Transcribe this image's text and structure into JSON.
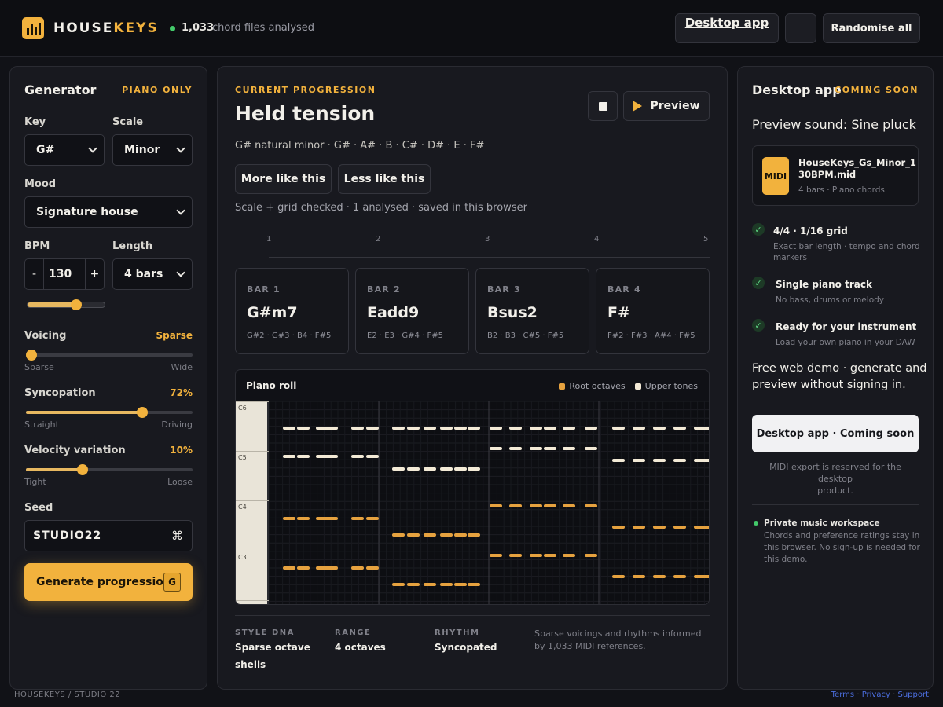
{
  "header": {
    "brand_part1": "HOUSE",
    "brand_part2": "KEYS",
    "files_count": "1,033",
    "files_text": "chord files analysed",
    "desktop_app_link": "Desktop app",
    "randomise_label": "Randomise all"
  },
  "generator": {
    "title": "Generator",
    "tag": "PIANO ONLY",
    "key_label": "Key",
    "key_value": "G#",
    "scale_label": "Scale",
    "scale_value": "Minor",
    "mood_label": "Mood",
    "mood_value": "Signature house",
    "bpm_label": "BPM",
    "bpm_value": "130",
    "bpm_minus": "-",
    "bpm_plus": "+",
    "length_label": "Length",
    "length_value": "4 bars",
    "voicing_label": "Voicing",
    "voicing_value": "Sparse",
    "voicing_min": "Sparse",
    "voicing_max": "Wide",
    "syncopation_label": "Syncopation",
    "syncopation_value": "72%",
    "syncopation_min": "Straight",
    "syncopation_max": "Driving",
    "velocity_label": "Velocity variation",
    "velocity_value": "10%",
    "velocity_min": "Tight",
    "velocity_max": "Loose",
    "seed_label": "Seed",
    "seed_value": "STUDIO22",
    "seed_icon_glyph": "⌘",
    "generate_label": "Generate progression",
    "generate_kbd": "G"
  },
  "progression": {
    "kicker": "CURRENT PROGRESSION",
    "title": "Held tension",
    "preview_label": "Preview",
    "scale_line": "G# natural minor · G# · A# · B · C# · D# · E · F#",
    "more_label": "More like this",
    "less_label": "Less like this",
    "status_line": "Scale + grid checked · 1 analysed · saved in this browser",
    "ruler": [
      "1",
      "2",
      "3",
      "4",
      "5"
    ],
    "bars": [
      {
        "label": "BAR 1",
        "chord": "G#m7",
        "notes": "G#2 · G#3 · B4 · F#5"
      },
      {
        "label": "BAR 2",
        "chord": "Eadd9",
        "notes": "E2 · E3 · G#4 · F#5"
      },
      {
        "label": "BAR 3",
        "chord": "Bsus2",
        "notes": "B2 · B3 · C#5 · F#5"
      },
      {
        "label": "BAR 4",
        "chord": "F#",
        "notes": "F#2 · F#3 · A#4 · F#5"
      }
    ],
    "roll_title": "Piano roll",
    "legend_root": "Root octaves",
    "legend_upper": "Upper tones",
    "octave_labels": [
      "C6",
      "C5",
      "C4",
      "C3"
    ],
    "stats": [
      {
        "head": "STYLE DNA",
        "value": "Sparse octave shells"
      },
      {
        "head": "RANGE",
        "value": "4 octaves"
      },
      {
        "head": "RHYTHM",
        "value": "Syncopated"
      }
    ],
    "stats_note": "Sparse voicings and rhythms informed by 1,033 MIDI references.",
    "colors": {
      "root": "#e6a23f",
      "upper": "#f3ead6"
    }
  },
  "desktop": {
    "title": "Desktop app",
    "tag": "COMING SOON",
    "preview_sound": "Preview sound: Sine pluck",
    "file_badge": "MIDI",
    "file_name_line1": "HouseKeys_Gs_Minor_1",
    "file_name_line2": "30BPM.mid",
    "file_meta": "4 bars · Piano chords",
    "features": [
      {
        "title": "4/4 · 1/16 grid",
        "desc_line1": "Exact bar length · tempo and chord",
        "desc_line2": "markers"
      },
      {
        "title": "Single piano track",
        "desc_line1": "No bass, drums or melody",
        "desc_line2": ""
      },
      {
        "title": "Ready for your instrument",
        "desc_line1": "Load your own piano in your DAW",
        "desc_line2": ""
      }
    ],
    "check_glyph": "✓",
    "free_demo_line1": "Free web demo · generate and",
    "free_demo_line2": "preview without signing in.",
    "cta_label": "Desktop app · Coming soon",
    "cta_note_line1": "MIDI export is reserved for the desktop",
    "cta_note_line2": "product.",
    "workspace_title": "Private music workspace",
    "workspace_line1": "Chords and preference ratings stay in",
    "workspace_line2": "this browser. No sign-up is needed for",
    "workspace_line3": "this demo."
  },
  "footer": {
    "left": "HOUSEKEYS / STUDIO 22",
    "terms": "Terms",
    "privacy": "Privacy",
    "support": "Support",
    "sep": "·"
  },
  "sliders": {
    "bpm": 0.62,
    "voicing": 0.0,
    "syncopation": 0.7,
    "velocity": 0.34
  }
}
